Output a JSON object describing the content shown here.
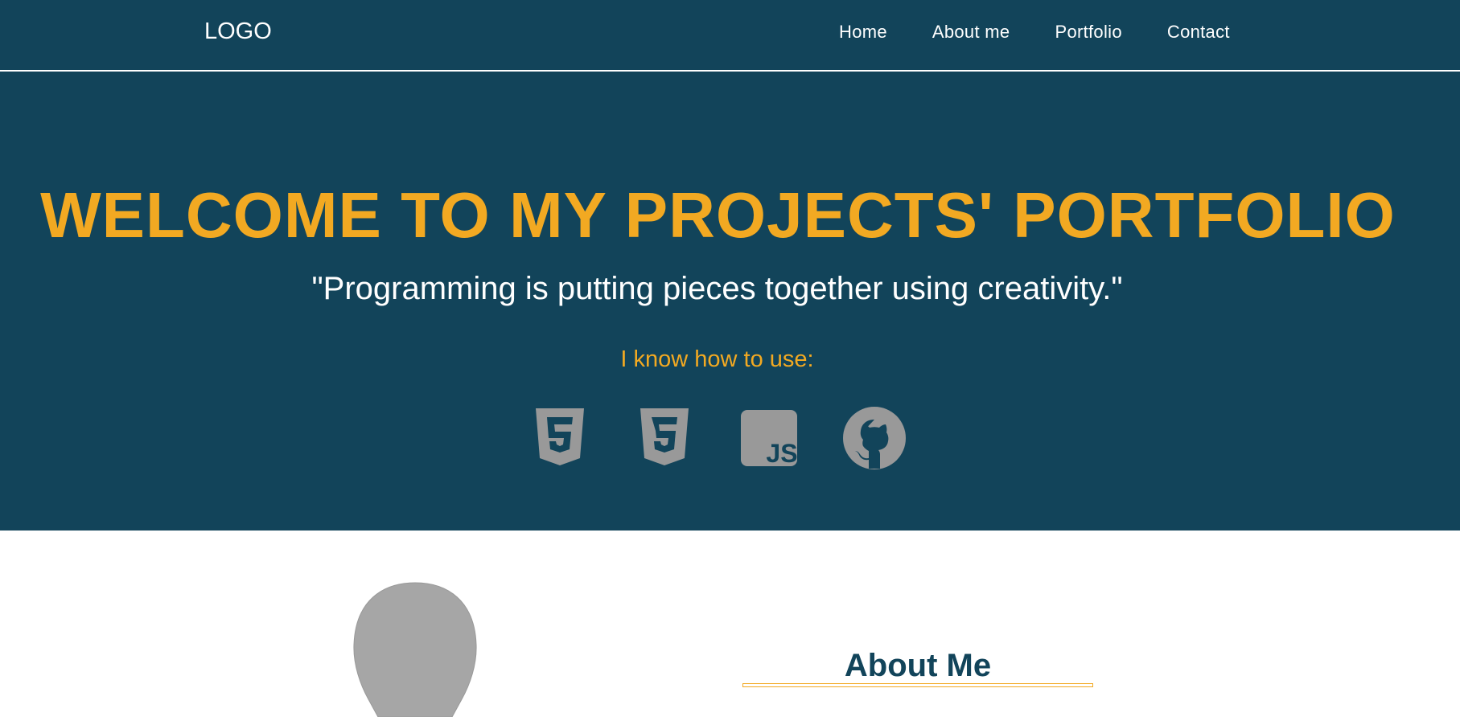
{
  "header": {
    "logo": "LOGO",
    "nav": [
      {
        "label": "Home"
      },
      {
        "label": "About me"
      },
      {
        "label": "Portfolio"
      },
      {
        "label": "Contact"
      }
    ]
  },
  "hero": {
    "title": "WELCOME TO MY PROJECTS' PORTFOLIO",
    "quote": "\"Programming is putting pieces together using creativity.\"",
    "skills_label": "I know how to use:",
    "skills": [
      {
        "icon": "html5-icon"
      },
      {
        "icon": "css3-icon"
      },
      {
        "icon": "javascript-icon",
        "text": "JS"
      },
      {
        "icon": "github-icon"
      }
    ]
  },
  "about": {
    "title": "About Me",
    "avatar_icon": "avatar-placeholder"
  },
  "colors": {
    "primary": "#12445a",
    "accent": "#f2a922",
    "icon": "#999999",
    "text_light": "#ffffff"
  }
}
